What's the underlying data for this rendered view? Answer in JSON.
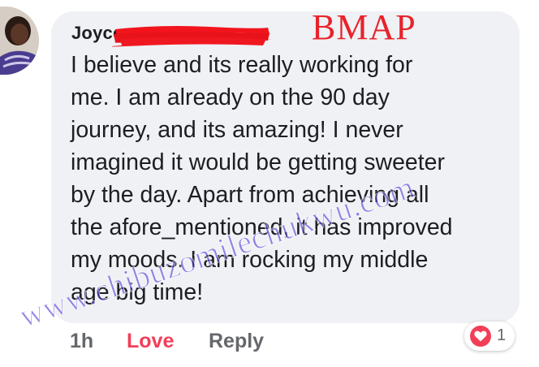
{
  "comment": {
    "author_visible": "Joy",
    "author_redacted_fragment": "ce",
    "text": "I believe and its really working for\nme. I am already on the 90 day\njourney, and its amazing! I never\nimagined it would be getting sweeter\nby the day. Apart from achieving all\nthe afore_mentioned, it has improved\nmy moods. I am rocking my middle\nage big time!"
  },
  "overlays": {
    "label": "BMAP",
    "watermark": "www.chibuzomilechukwu.com"
  },
  "footer": {
    "time": "1h",
    "love_label": "Love",
    "reply_label": "Reply",
    "reaction_icon": "heart-icon",
    "reaction_count": "1"
  },
  "colors": {
    "bubble": "#eff1f5",
    "love": "#f33e58",
    "meta": "#65676b",
    "label_red": "#e8232a",
    "watermark_purple": "#5a3fd8"
  }
}
